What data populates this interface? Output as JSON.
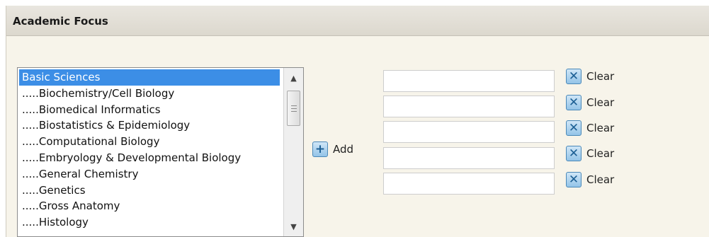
{
  "panel": {
    "title": "Academic Focus"
  },
  "listbox": {
    "items": [
      "Basic Sciences",
      ".....Biochemistry/Cell Biology",
      ".....Biomedical Informatics",
      ".....Biostatistics & Epidemiology",
      ".....Computational Biology",
      ".....Embryology & Developmental Biology",
      ".....General Chemistry",
      ".....Genetics",
      ".....Gross Anatomy",
      ".....Histology"
    ],
    "selected_index": 0
  },
  "add_button": {
    "label": "Add",
    "icon": "plus-icon"
  },
  "selected_fields": [
    {
      "value": "",
      "clear_label": "Clear",
      "icon": "close-icon"
    },
    {
      "value": "",
      "clear_label": "Clear",
      "icon": "close-icon"
    },
    {
      "value": "",
      "clear_label": "Clear",
      "icon": "close-icon"
    },
    {
      "value": "",
      "clear_label": "Clear",
      "icon": "close-icon"
    },
    {
      "value": "",
      "clear_label": "Clear",
      "icon": "close-icon"
    }
  ],
  "colors": {
    "selection": "#3c8ee6",
    "panel_background": "#f7f4ea",
    "icon_blue": "#4a88b8"
  }
}
